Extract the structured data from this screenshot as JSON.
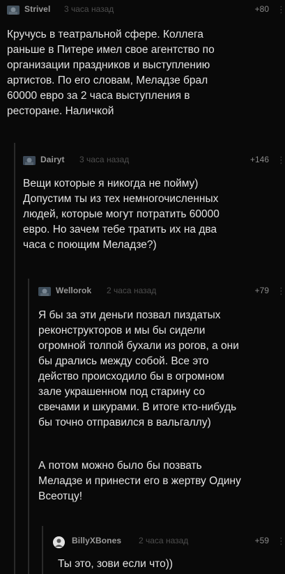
{
  "comments": [
    {
      "username": "Strivel",
      "time": "3 часа назад",
      "score": "+80",
      "more_icon": "⋮",
      "paragraphs": [
        "Кручусь в театральной сфере. Коллега\nраньше в Питере имел свое агентство по\nорганизации праздников и выступлению\nартистов. По его словам, Меладзе брал\n60000 евро за 2 часа выступления в\nресторане. Наличкой"
      ]
    },
    {
      "username": "Dairyt",
      "time": "3 часа назад",
      "score": "+146",
      "more_icon": "⋮",
      "paragraphs": [
        "Вещи которые я никогда не пойму)\nДопустим ты из тех немногочисленных\nлюдей, которые могут потратить 60000\nевро. Но зачем тебе тратить их на два\nчаса с поющим Меладзе?)"
      ]
    },
    {
      "username": "Wellorok",
      "time": "2 часа назад",
      "score": "+79",
      "more_icon": "⋮",
      "paragraphs": [
        "Я бы за эти деньги позвал пиздатых\nреконструкторов и мы бы сидели\nогромной толпой бухали из рогов, а они\nбы дрались между собой. Все это\nдейство происходило бы в огромном\nзале украшенном под старину со\nсвечами и шкурами. В итоге кто-нибудь\nбы точно отправился в вальгаллу)",
        "А потом можно было бы позвать\nМеладзе и принести его в жертву Одину\nВсеотцу!"
      ]
    },
    {
      "username": "BillyXBones",
      "time": "2 часа назад",
      "score": "+59",
      "more_icon": "⋮",
      "paragraphs": [
        "Ты это, зови если что))"
      ]
    }
  ]
}
